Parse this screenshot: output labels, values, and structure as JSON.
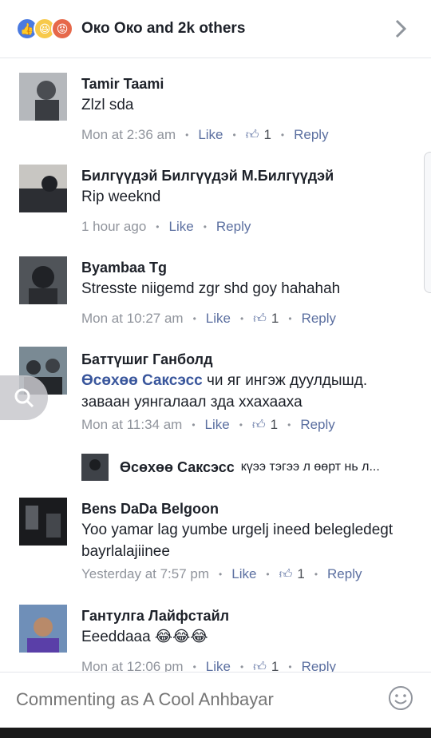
{
  "header": {
    "title": "Око Око and 2k others",
    "reactions": [
      "like",
      "haha",
      "angry"
    ]
  },
  "comments": [
    {
      "name": "Tamir Taami",
      "text": "Zlzl sda",
      "time": "Mon at 2:36 am",
      "like": "Like",
      "count": "1",
      "reply": "Reply"
    },
    {
      "name": "Билгүүдэй Билгүүдэй М.Билгүүдэй",
      "text": "Rip weeknd",
      "time": "1 hour ago",
      "like": "Like",
      "count": "",
      "reply": "Reply"
    },
    {
      "name": "Byambaa Tg",
      "text": "Stresste niigemd zgr shd goy hahahah",
      "time": "Mon at 10:27 am",
      "like": "Like",
      "count": "1",
      "reply": "Reply"
    },
    {
      "name": "Баттүшиг Ганболд",
      "text_highlight": "Өсөхөө Саксэсс",
      "text": " чи яг ингэж дуулдышд. заваан уянгалаал зда ххахааха",
      "time": "Mon at 11:34 am",
      "like": "Like",
      "count": "1",
      "reply": "Reply"
    },
    {
      "name": "Bens DaDa Belgoon",
      "text": "Yoo yamar lag yumbe urgelj ineed belegledegt bayrlalajiinee",
      "time": "Yesterday at 7:57 pm",
      "like": "Like",
      "count": "1",
      "reply": "Reply"
    },
    {
      "name": "Гантулга Лайфстайл",
      "text": "Eeeddaaa 😂😂😂",
      "time": "Mon at 12:06 pm",
      "like": "Like",
      "count": "1",
      "reply": "Reply"
    }
  ],
  "nested_reply": {
    "name": "Өсөхөө Саксэсс",
    "text": "күээ тэгээ л өөрт нь л..."
  },
  "footer": {
    "placeholder": "Commenting as A Cool Anhbayar"
  }
}
